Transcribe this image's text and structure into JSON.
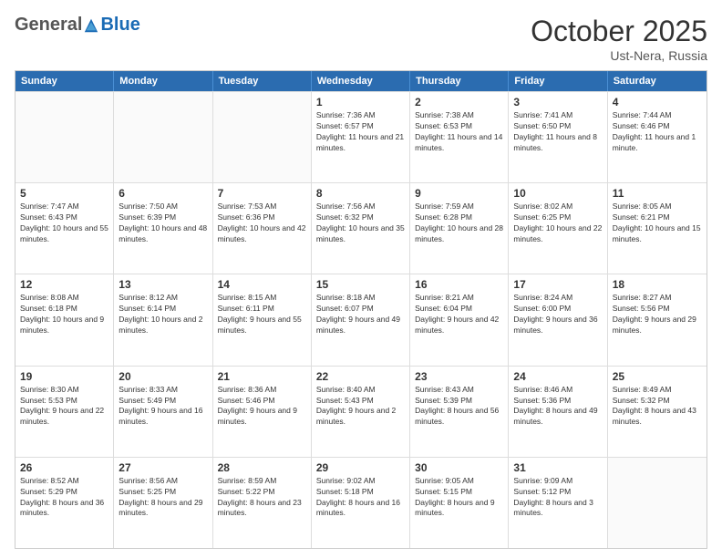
{
  "header": {
    "logo": {
      "general": "General",
      "blue": "Blue"
    },
    "title": "October 2025",
    "subtitle": "Ust-Nera, Russia"
  },
  "weekdays": [
    "Sunday",
    "Monday",
    "Tuesday",
    "Wednesday",
    "Thursday",
    "Friday",
    "Saturday"
  ],
  "weeks": [
    [
      {
        "day": "",
        "empty": true
      },
      {
        "day": "",
        "empty": true
      },
      {
        "day": "",
        "empty": true
      },
      {
        "day": "1",
        "sunrise": "7:36 AM",
        "sunset": "6:57 PM",
        "daylight": "11 hours and 21 minutes."
      },
      {
        "day": "2",
        "sunrise": "7:38 AM",
        "sunset": "6:53 PM",
        "daylight": "11 hours and 14 minutes."
      },
      {
        "day": "3",
        "sunrise": "7:41 AM",
        "sunset": "6:50 PM",
        "daylight": "11 hours and 8 minutes."
      },
      {
        "day": "4",
        "sunrise": "7:44 AM",
        "sunset": "6:46 PM",
        "daylight": "11 hours and 1 minute."
      }
    ],
    [
      {
        "day": "5",
        "sunrise": "7:47 AM",
        "sunset": "6:43 PM",
        "daylight": "10 hours and 55 minutes."
      },
      {
        "day": "6",
        "sunrise": "7:50 AM",
        "sunset": "6:39 PM",
        "daylight": "10 hours and 48 minutes."
      },
      {
        "day": "7",
        "sunrise": "7:53 AM",
        "sunset": "6:36 PM",
        "daylight": "10 hours and 42 minutes."
      },
      {
        "day": "8",
        "sunrise": "7:56 AM",
        "sunset": "6:32 PM",
        "daylight": "10 hours and 35 minutes."
      },
      {
        "day": "9",
        "sunrise": "7:59 AM",
        "sunset": "6:28 PM",
        "daylight": "10 hours and 28 minutes."
      },
      {
        "day": "10",
        "sunrise": "8:02 AM",
        "sunset": "6:25 PM",
        "daylight": "10 hours and 22 minutes."
      },
      {
        "day": "11",
        "sunrise": "8:05 AM",
        "sunset": "6:21 PM",
        "daylight": "10 hours and 15 minutes."
      }
    ],
    [
      {
        "day": "12",
        "sunrise": "8:08 AM",
        "sunset": "6:18 PM",
        "daylight": "10 hours and 9 minutes."
      },
      {
        "day": "13",
        "sunrise": "8:12 AM",
        "sunset": "6:14 PM",
        "daylight": "10 hours and 2 minutes."
      },
      {
        "day": "14",
        "sunrise": "8:15 AM",
        "sunset": "6:11 PM",
        "daylight": "9 hours and 55 minutes."
      },
      {
        "day": "15",
        "sunrise": "8:18 AM",
        "sunset": "6:07 PM",
        "daylight": "9 hours and 49 minutes."
      },
      {
        "day": "16",
        "sunrise": "8:21 AM",
        "sunset": "6:04 PM",
        "daylight": "9 hours and 42 minutes."
      },
      {
        "day": "17",
        "sunrise": "8:24 AM",
        "sunset": "6:00 PM",
        "daylight": "9 hours and 36 minutes."
      },
      {
        "day": "18",
        "sunrise": "8:27 AM",
        "sunset": "5:56 PM",
        "daylight": "9 hours and 29 minutes."
      }
    ],
    [
      {
        "day": "19",
        "sunrise": "8:30 AM",
        "sunset": "5:53 PM",
        "daylight": "9 hours and 22 minutes."
      },
      {
        "day": "20",
        "sunrise": "8:33 AM",
        "sunset": "5:49 PM",
        "daylight": "9 hours and 16 minutes."
      },
      {
        "day": "21",
        "sunrise": "8:36 AM",
        "sunset": "5:46 PM",
        "daylight": "9 hours and 9 minutes."
      },
      {
        "day": "22",
        "sunrise": "8:40 AM",
        "sunset": "5:43 PM",
        "daylight": "9 hours and 2 minutes."
      },
      {
        "day": "23",
        "sunrise": "8:43 AM",
        "sunset": "5:39 PM",
        "daylight": "8 hours and 56 minutes."
      },
      {
        "day": "24",
        "sunrise": "8:46 AM",
        "sunset": "5:36 PM",
        "daylight": "8 hours and 49 minutes."
      },
      {
        "day": "25",
        "sunrise": "8:49 AM",
        "sunset": "5:32 PM",
        "daylight": "8 hours and 43 minutes."
      }
    ],
    [
      {
        "day": "26",
        "sunrise": "8:52 AM",
        "sunset": "5:29 PM",
        "daylight": "8 hours and 36 minutes."
      },
      {
        "day": "27",
        "sunrise": "8:56 AM",
        "sunset": "5:25 PM",
        "daylight": "8 hours and 29 minutes."
      },
      {
        "day": "28",
        "sunrise": "8:59 AM",
        "sunset": "5:22 PM",
        "daylight": "8 hours and 23 minutes."
      },
      {
        "day": "29",
        "sunrise": "9:02 AM",
        "sunset": "5:18 PM",
        "daylight": "8 hours and 16 minutes."
      },
      {
        "day": "30",
        "sunrise": "9:05 AM",
        "sunset": "5:15 PM",
        "daylight": "8 hours and 9 minutes."
      },
      {
        "day": "31",
        "sunrise": "9:09 AM",
        "sunset": "5:12 PM",
        "daylight": "8 hours and 3 minutes."
      },
      {
        "day": "",
        "empty": true
      }
    ]
  ]
}
